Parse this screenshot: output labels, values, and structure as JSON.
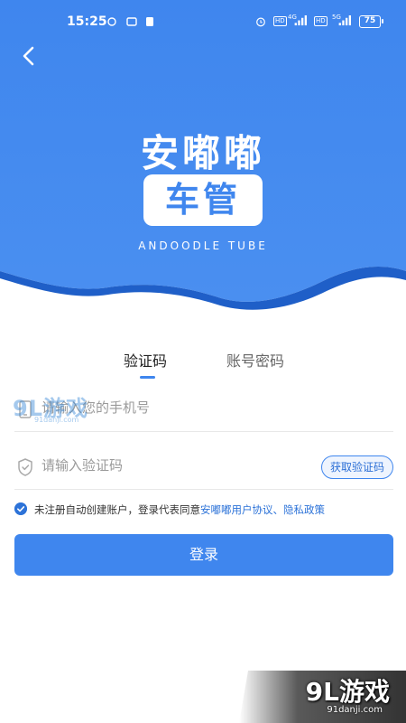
{
  "status_bar": {
    "time": "15:25",
    "network_1": "4G",
    "network_2": "5G",
    "hd_1": "HD",
    "hd_2": "HD",
    "battery": "75"
  },
  "header": {
    "back_icon": "chevron-left-icon",
    "logo_title": "安嘟嘟",
    "logo_box": "车管",
    "logo_subtitle": "ANDOODLE TUBE"
  },
  "tabs": [
    {
      "label": "验证码",
      "active": true
    },
    {
      "label": "账号密码",
      "active": false
    }
  ],
  "form": {
    "phone_placeholder": "请输入您的手机号",
    "code_placeholder": "请输入验证码",
    "get_code_label": "获取验证码",
    "phone_icon": "phone-icon",
    "code_icon": "shield-check-icon"
  },
  "agreement": {
    "checked": true,
    "prefix": "未注册自动创建账户，登录代表同意",
    "user_agreement": "安嘟嘟用户协议",
    "separator": "、",
    "privacy_policy": "隐私政策"
  },
  "login_button": "登录",
  "watermarks": {
    "brand": "9L游戏",
    "url": "91danji.com"
  },
  "colors": {
    "primary": "#3f86ee",
    "primary_dark": "#1f5fc8",
    "link": "#2d73d8"
  }
}
